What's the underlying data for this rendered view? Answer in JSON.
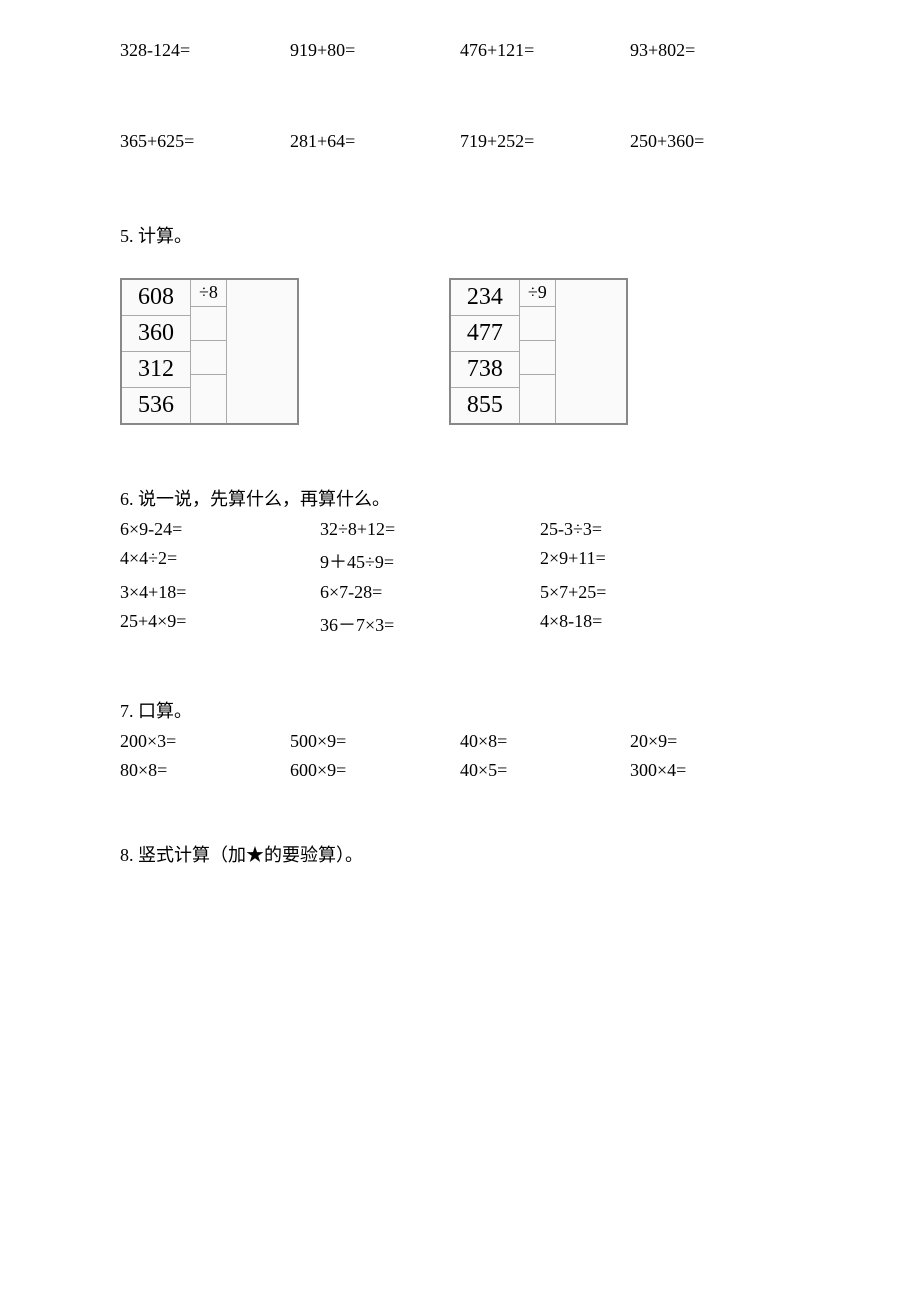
{
  "top_rows": [
    [
      "328-124=",
      "919+80=",
      "476+121=",
      "93+802="
    ],
    [
      "365+625=",
      "281+64=",
      "719+252=",
      "250+360="
    ]
  ],
  "q5": {
    "title": "5. 计算。",
    "tables": [
      {
        "op": "÷8",
        "values": [
          "608",
          "360",
          "312",
          "536"
        ]
      },
      {
        "op": "÷9",
        "values": [
          "234",
          "477",
          "738",
          "855"
        ]
      }
    ]
  },
  "q6": {
    "title": "6. 说一说，先算什么，再算什么。",
    "rows": [
      [
        "6×9-24=",
        "32÷8+12=",
        "25-3÷3="
      ],
      [
        "4×4÷2=",
        "9＋45÷9=",
        "2×9+11="
      ],
      [
        "3×4+18=",
        "6×7-28=",
        "5×7+25="
      ],
      [
        "25+4×9=",
        "36－7×3=",
        "4×8-18="
      ]
    ]
  },
  "q7": {
    "title": "7. 口算。",
    "rows": [
      [
        "200×3=",
        "500×9=",
        "40×8=",
        "20×9="
      ],
      [
        "80×8=",
        "600×9=",
        "40×5=",
        "300×4="
      ]
    ]
  },
  "q8": {
    "title": "8. 竖式计算（加★的要验算）。"
  }
}
